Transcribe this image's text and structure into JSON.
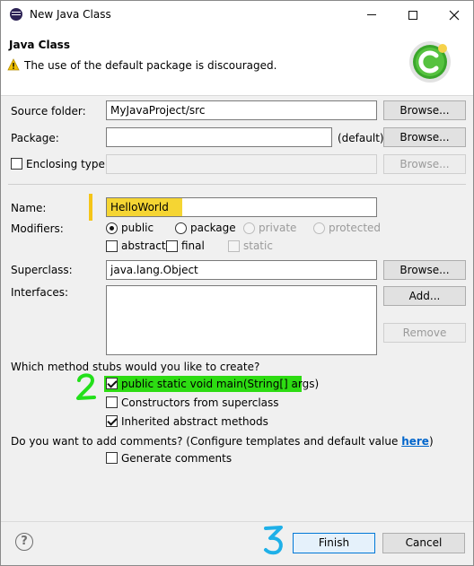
{
  "window": {
    "title": "New Java Class"
  },
  "header": {
    "title": "Java Class",
    "warning": "The use of the default package is discouraged."
  },
  "form": {
    "source_folder": {
      "label": "Source folder:",
      "value": "MyJavaProject/src",
      "browse": "Browse..."
    },
    "package": {
      "label": "Package:",
      "value": "",
      "suffix": "(default)",
      "browse": "Browse..."
    },
    "enclosing_type": {
      "label": "Enclosing type:",
      "value": "",
      "checked": false,
      "browse": "Browse..."
    },
    "name": {
      "label": "Name:",
      "value": "HelloWorld"
    },
    "modifiers": {
      "label": "Modifiers:",
      "access": [
        {
          "label": "public",
          "selected": true,
          "enabled": true
        },
        {
          "label": "package",
          "selected": false,
          "enabled": true
        },
        {
          "label": "private",
          "selected": false,
          "enabled": false
        },
        {
          "label": "protected",
          "selected": false,
          "enabled": false
        }
      ],
      "flags": [
        {
          "label": "abstract",
          "checked": false,
          "enabled": true
        },
        {
          "label": "final",
          "checked": false,
          "enabled": true
        },
        {
          "label": "static",
          "checked": false,
          "enabled": false
        }
      ]
    },
    "superclass": {
      "label": "Superclass:",
      "value": "java.lang.Object",
      "browse": "Browse..."
    },
    "interfaces": {
      "label": "Interfaces:",
      "add": "Add...",
      "remove": "Remove"
    }
  },
  "stubs": {
    "question": "Which method stubs would you like to create?",
    "options": [
      {
        "label": "public static void main(String[] args)",
        "checked": true
      },
      {
        "label": "Constructors from superclass",
        "checked": false
      },
      {
        "label": "Inherited abstract methods",
        "checked": true
      }
    ]
  },
  "comments": {
    "question_prefix": "Do you want to add comments? (Configure templates and default value ",
    "link": "here",
    "question_suffix": ")",
    "option": {
      "label": "Generate comments",
      "checked": false
    }
  },
  "annotations": {
    "step2": "2",
    "step3": "3"
  },
  "footer": {
    "finish": "Finish",
    "cancel": "Cancel"
  },
  "colors": {
    "highlight_yellow": "#f5d533",
    "highlight_green": "#2ddc12",
    "annotation_blue": "#1fb0e8",
    "annotation_green": "#23e01a"
  }
}
